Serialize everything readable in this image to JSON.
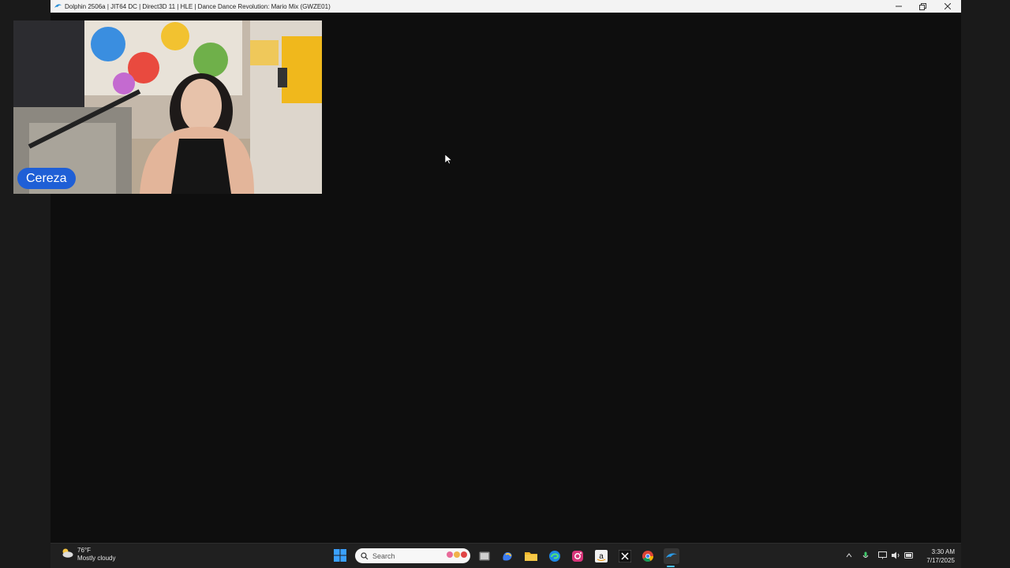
{
  "window": {
    "title": "Dolphin 2506a | JIT64 DC | Direct3D 11 | HLE | Dance Dance Revolution: Mario Mix (GWZE01)",
    "minimize_icon": "minimize-icon",
    "restore_icon": "restore-icon",
    "close_icon": "close-icon"
  },
  "webcam": {
    "name": "Cereza",
    "tag_color": "#1f5fd6"
  },
  "taskbar": {
    "weather": {
      "temp": "76°F",
      "condition": "Mostly cloudy",
      "icon": "partly-cloudy-icon"
    },
    "search": {
      "placeholder": "Search"
    },
    "pinned": [
      "task-view-icon",
      "copilot-icon",
      "file-explorer-icon",
      "edge-icon",
      "instagram-icon",
      "amazon-icon",
      "x-icon",
      "chrome-icon",
      "dolphin-icon"
    ],
    "tray": [
      "chevron-up-icon",
      "microphone-icon",
      "network-icon",
      "volume-icon",
      "battery-icon"
    ],
    "clock": {
      "time": "3:30 AM",
      "date": "7/17/2025"
    }
  },
  "colors": {
    "accent": "#4cc2ff",
    "taskbar": "#202020",
    "game_bg": "#0e0e0e"
  }
}
